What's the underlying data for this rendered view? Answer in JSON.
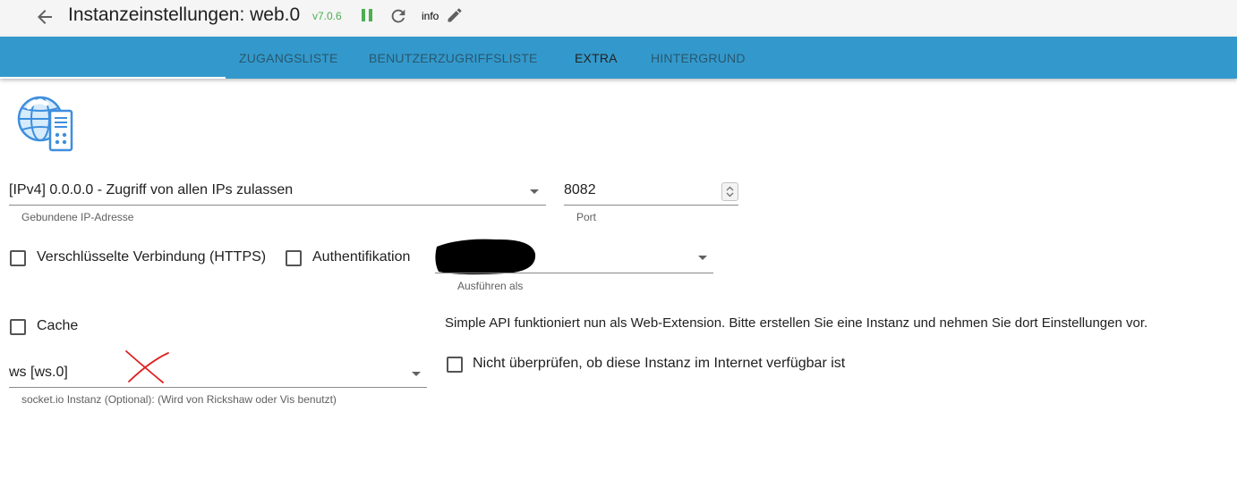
{
  "header": {
    "title": "Instanzeinstellungen: web.0",
    "version": "v7.0.6",
    "log_level": "info",
    "colors": {
      "version": "#4caf50",
      "pause": "#4caf50",
      "tabbar": "#3399cc"
    },
    "icons": [
      "arrow-left-icon",
      "pause-icon",
      "reload-icon",
      "pencil-icon"
    ]
  },
  "tabs": [
    {
      "label": "ZUGANGSLISTE",
      "active": false
    },
    {
      "label": "BENUTZERZUGRIFFSLISTE",
      "active": false
    },
    {
      "label": "EXTRA",
      "active": true
    },
    {
      "label": "HINTERGRUND",
      "active": false
    }
  ],
  "form": {
    "bind": {
      "value": "[IPv4] 0.0.0.0 - Zugriff von allen IPs zulassen",
      "label": "Gebundene IP-Adresse"
    },
    "port": {
      "value": "8082",
      "label": "Port"
    },
    "https": {
      "label": "Verschlüsselte Verbindung (HTTPS)",
      "checked": false
    },
    "auth": {
      "label": "Authentifikation",
      "checked": false
    },
    "run_as": {
      "value": "",
      "label": "Ausführen als"
    },
    "cache": {
      "label": "Cache",
      "checked": false
    },
    "socketio": {
      "value": "ws [ws.0]",
      "label": "socket.io Instanz (Optional): (Wird von Rickshaw oder Vis benutzt)"
    },
    "simple_api_note": "Simple API funktioniert nun als Web-Extension. Bitte erstellen Sie eine Instanz und nehmen Sie dort Einstellungen vor.",
    "no_check": {
      "label": "Nicht überprüfen, ob diese Instanz im Internet verfügbar ist",
      "checked": false
    }
  }
}
